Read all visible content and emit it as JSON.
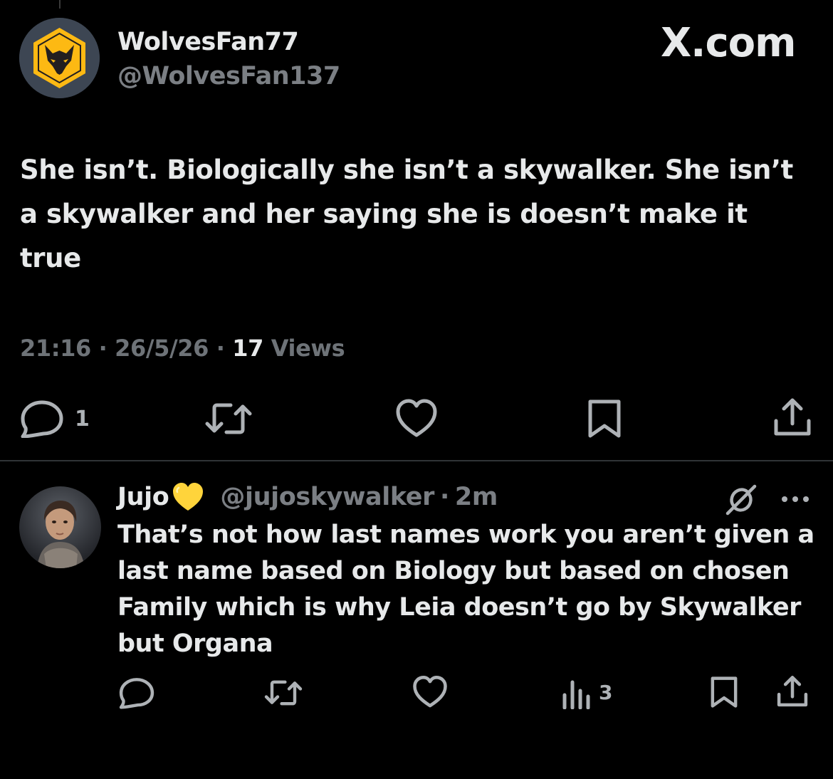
{
  "watermark": "X.com",
  "main_tweet": {
    "display_name": "WolvesFan77",
    "handle": "@WolvesFan137",
    "text": "She isn’t. Biologically she isn’t a skywalker. She isn’t a skywalker and her saying she is doesn’t make it true",
    "time": "21:16",
    "date": "26/5/26",
    "separator": " · ",
    "views_count": "17",
    "views_label": " Views",
    "reply_count": "1",
    "avatar_icon": "wolves-crest-icon"
  },
  "reply": {
    "display_name": "Jujo",
    "badge_icon": "yellow-heart-icon",
    "handle": "@jujoskywalker",
    "separator": "·",
    "time": "2m",
    "text": "That’s not how last names work you aren’t given a last name based on Biology but based on chosen Family which is why Leia doesn’t go by Skywalker but Organa",
    "views_count": "3"
  },
  "colors": {
    "background": "#000000",
    "text": "#e7e9ea",
    "muted": "#7b7f84",
    "icon": "#aeb2b6",
    "divider": "#2f3336",
    "wolves_gold": "#fdb913",
    "heart_yellow": "#ffd43b"
  }
}
